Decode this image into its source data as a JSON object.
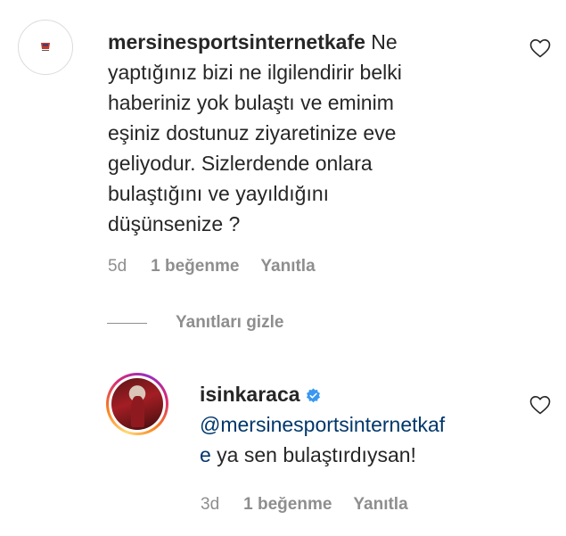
{
  "comment": {
    "username": "mersinesportsinternetkafe",
    "lines": [
      " Ne",
      "yaptığınız bizi ne ilgilendirir belki",
      "haberiniz yok bulaştı ve eminim",
      "eşiniz dostunuz ziyaretinize eve",
      "geliyodur. Sizlerdende onlara",
      "bulaştığını ve yayıldığını",
      "düşünsenize ?"
    ],
    "time": "5d",
    "likes": "1 beğenme",
    "reply_label": "Yanıtla",
    "avatar_icon": "cafe-logo-icon",
    "like_icon": "heart-outline-icon"
  },
  "hide_replies_label": "Yanıtları gizle",
  "reply": {
    "username": "isinkaraca",
    "verified_icon": "verified-badge-icon",
    "mention_line1": "@mersinesportsinternetkaf",
    "mention_line2_mention": "e",
    "text_line2": " ya sen bulaştırdıysan!",
    "time": "3d",
    "likes": "1 beğenme",
    "reply_label": "Yanıtla",
    "like_icon": "heart-outline-icon"
  },
  "colors": {
    "text": "#262626",
    "muted": "#8e8e8e",
    "mention": "#00376b",
    "verified": "#3897f0"
  }
}
